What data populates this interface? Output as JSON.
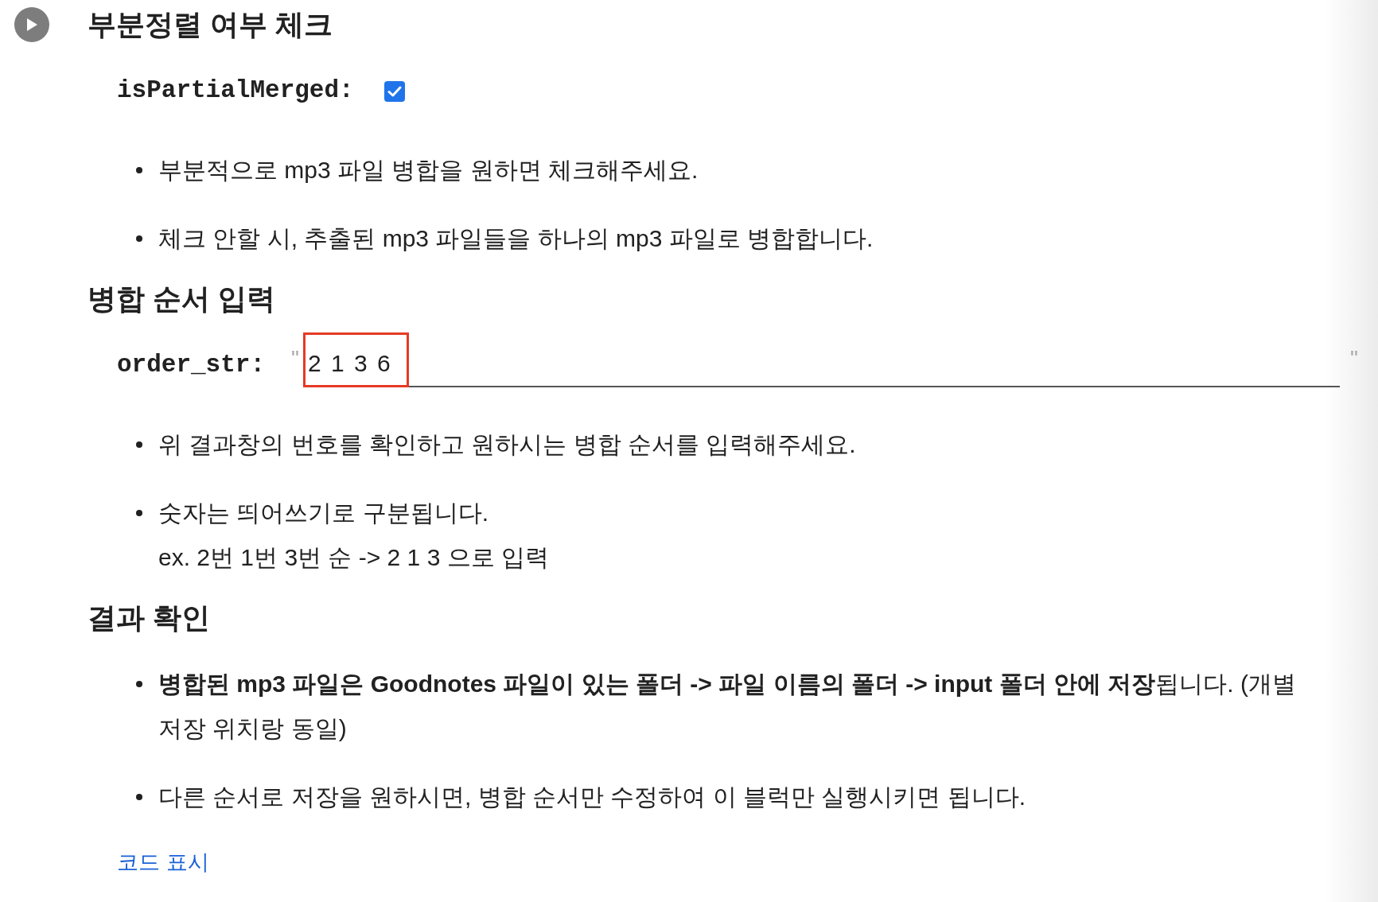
{
  "sections": [
    {
      "title": "부분정렬 여부 체크",
      "field": {
        "kind": "checkbox",
        "label": "isPartialMerged:",
        "checked": true
      },
      "notes": [
        "부분적으로 mp3 파일 병합을 원하면 체크해주세요.",
        "체크 안할 시, 추출된 mp3 파일들을 하나의 mp3 파일로 병합합니다."
      ]
    },
    {
      "title": "병합 순서 입력",
      "field": {
        "kind": "text",
        "label": "order_str:",
        "quote_open": "\"",
        "value": "2 1 3 6",
        "quote_close": "\"",
        "highlighted": true
      },
      "notes": [
        "위 결과창의 번호를 확인하고 원하시는 병합 순서를 입력해주세요.",
        "숫자는 띄어쓰기로 구분됩니다.\nex. 2번 1번 3번 순 -> 2 1 3 으로 입력"
      ]
    },
    {
      "title": "결과 확인",
      "notes": [
        "**병합된 mp3 파일은 Goodnotes 파일이 있는 폴더 -> 파일 이름의 폴더 -> input 폴더 안에 저장**됩니다. (개별 저장 위치랑 동일)",
        "다른 순서로 저장을 원하시면, 병합 순서만 수정하여 이 블럭만 실행시키면 됩니다."
      ]
    }
  ],
  "show_code_link": "코드 표시"
}
